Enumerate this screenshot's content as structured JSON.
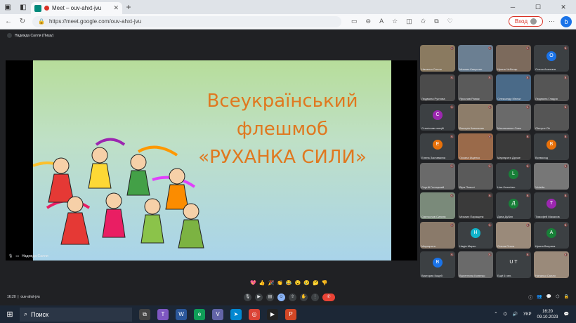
{
  "browser": {
    "tab_title": "Meet – ouv-ahxt-jvu",
    "url": "https://meet.google.com/ouv-ahxt-jvu",
    "signin_label": "Вход"
  },
  "meet": {
    "presenter_chip": "Надежда Салли (Пишу)",
    "stage_label": "Надежда Салли",
    "slide_title_lines": [
      "Всеукраїнський",
      "флешмоб",
      "«РУХАНКА СИЛИ»"
    ],
    "meeting_time": "16:20",
    "meeting_code": "ouv-ahxt-jvu",
    "reactions": [
      "💖",
      "👍",
      "🎉",
      "👏",
      "😂",
      "😮",
      "😢",
      "🤔",
      "👎"
    ],
    "participants": [
      {
        "name": "Наталья Салли",
        "letter": "",
        "color": "#8a7a60"
      },
      {
        "name": "Михаил Капустин",
        "letter": "",
        "color": "#6b7f92"
      },
      {
        "name": "Ирина Чеботар",
        "letter": "",
        "color": "#7c6a5c"
      },
      {
        "name": "Олеся Асютина",
        "letter": "О",
        "color": "#1a73e8"
      },
      {
        "name": "Людмила Рустова",
        "letter": "",
        "color": "#4b4b4b"
      },
      {
        "name": "Ярослав Рамик",
        "letter": "",
        "color": "#5a5a5a"
      },
      {
        "name": "Олександр Мельн",
        "letter": "",
        "color": "#4a6a88"
      },
      {
        "name": "Людмила Гладия",
        "letter": "",
        "color": "#555"
      },
      {
        "name": "Сталіслав спецій",
        "letter": "С",
        "color": "#9c27b0"
      },
      {
        "name": "Валерія Ковальчик",
        "letter": "",
        "color": "#8d7d6a"
      },
      {
        "name": "Маслюченко Олек",
        "letter": "",
        "color": "#6a6a6a"
      },
      {
        "name": "Olenyuv Ok",
        "letter": "",
        "color": "#555"
      },
      {
        "name": "Елена Заставкина",
        "letter": "E",
        "color": "#e8710a"
      },
      {
        "name": "Оксана Ищенко",
        "letter": "",
        "color": "#9a6a4a"
      },
      {
        "name": "Маргарита Друже",
        "letter": "",
        "color": "#3a3a3a"
      },
      {
        "name": "Всеволод",
        "letter": "В",
        "color": "#e8710a"
      },
      {
        "name": "Сергій Голоцький",
        "letter": "",
        "color": "#6a6a6a"
      },
      {
        "name": "Віра Поволі",
        "letter": "",
        "color": "#5a5a5a"
      },
      {
        "name": "Lisa Kravchen",
        "letter": "L",
        "color": "#188038"
      },
      {
        "name": "Violetta",
        "letter": "",
        "color": "#777"
      },
      {
        "name": "Святослав Синєєв",
        "letter": "",
        "color": "#7a8a7a"
      },
      {
        "name": "Михаил Паращенк",
        "letter": "",
        "color": "#3a3a3a"
      },
      {
        "name": "Дана Дубан",
        "letter": "Д",
        "color": "#188038"
      },
      {
        "name": "Тимофей Мазалов",
        "letter": "T",
        "color": "#9c27b0"
      },
      {
        "name": "Маргарита",
        "letter": "",
        "color": "#8a7a6a"
      },
      {
        "name": "Надія Марко",
        "letter": "Н",
        "color": "#12b5cb"
      },
      {
        "name": "Олена Ольга",
        "letter": "",
        "color": "#9a8a7a"
      },
      {
        "name": "Ирина Ватрина",
        "letter": "А",
        "color": "#188038"
      },
      {
        "name": "Виктория Коцей",
        "letter": "В",
        "color": "#1a73e8"
      },
      {
        "name": "Валентина Коненко",
        "letter": "",
        "color": "#6a6a6a"
      },
      {
        "name": "Ещё 6 чел.",
        "letter": "U T",
        "color": "#3c4043"
      },
      {
        "name": "Наталья Салли",
        "letter": "",
        "color": "#9a8a7a"
      }
    ]
  },
  "taskbar": {
    "search_label": "Поиск",
    "language": "УКР",
    "time": "16:20",
    "date": "09.10.2023"
  },
  "icons": {
    "start": "windows-start-icon",
    "search": "search-icon",
    "mic": "mic-icon",
    "camera": "camera-icon",
    "hangup": "end-call-icon"
  }
}
